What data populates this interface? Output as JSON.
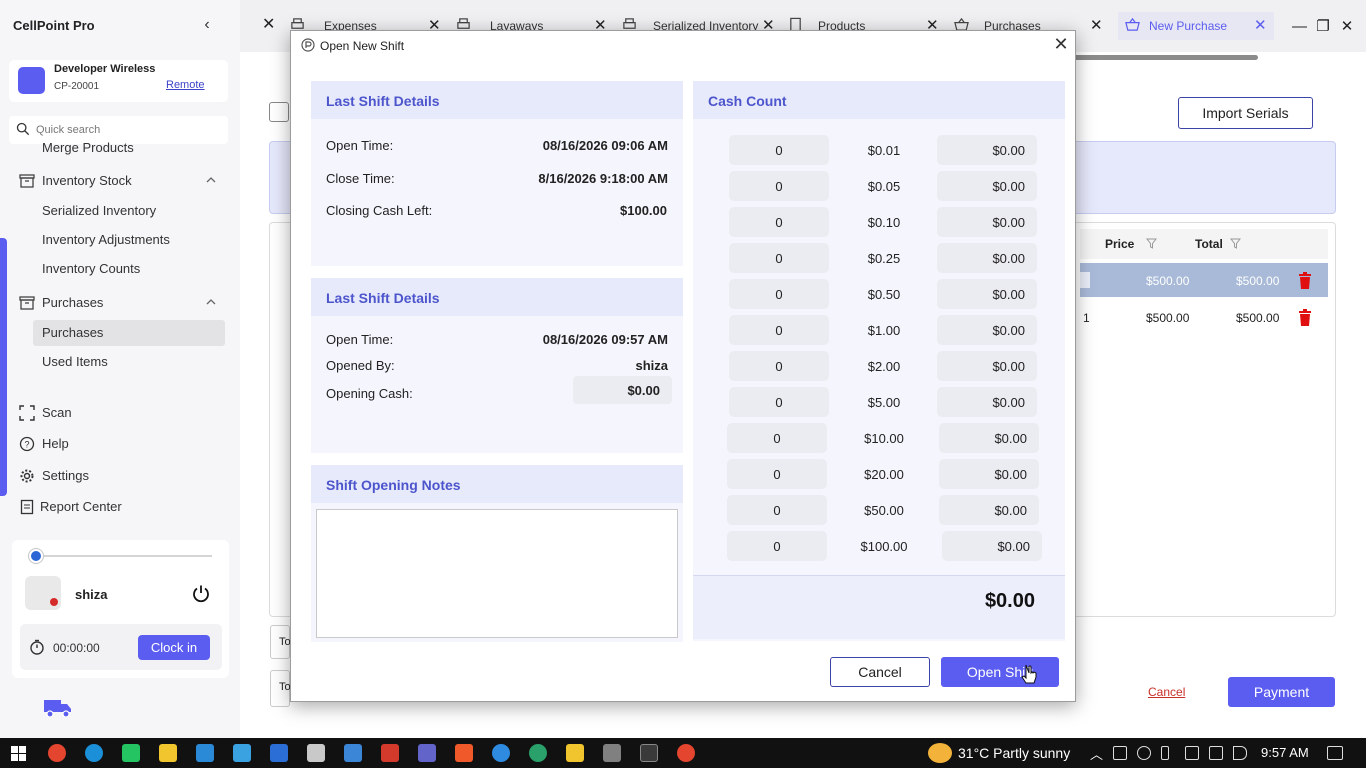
{
  "app": {
    "title": "CellPoint Pro"
  },
  "store": {
    "name": "Developer Wireless",
    "id": "CP-20001",
    "remote_label": "Remote"
  },
  "search": {
    "placeholder": "Quick search"
  },
  "sidebar": {
    "items": [
      {
        "label": "Merge Products"
      },
      {
        "label": "Inventory Stock"
      },
      {
        "label": "Serialized Inventory"
      },
      {
        "label": "Inventory Adjustments"
      },
      {
        "label": "Inventory Counts"
      },
      {
        "label": "Purchases"
      },
      {
        "label": "Purchases"
      },
      {
        "label": "Used Items"
      },
      {
        "label": "Scan"
      },
      {
        "label": "Help"
      },
      {
        "label": "Settings"
      },
      {
        "label": "Report Center"
      }
    ]
  },
  "user": {
    "name": "shiza",
    "timer": "00:00:00",
    "clock_in_label": "Clock in"
  },
  "tabs": [
    {
      "label": "Expenses"
    },
    {
      "label": "Layaways"
    },
    {
      "label": "Serialized Inventory"
    },
    {
      "label": "Products"
    },
    {
      "label": "Purchases"
    },
    {
      "label": "New Purchase"
    }
  ],
  "page": {
    "import_label": "Import Serials",
    "table_headers": {
      "price": "Price",
      "total": "Total"
    },
    "rows": [
      {
        "qty": "",
        "price": "$500.00",
        "total": "$500.00"
      },
      {
        "qty": "1",
        "price": "$500.00",
        "total": "$500.00"
      }
    ],
    "bottom_labels": [
      "To",
      "To"
    ],
    "cancel_label": "Cancel",
    "payment_label": "Payment"
  },
  "modal": {
    "title": "Open New Shift",
    "last_shift": {
      "heading": "Last Shift Details",
      "open_time_label": "Open Time:",
      "open_time": "08/16/2026 09:06 AM",
      "close_time_label": "Close Time:",
      "close_time": "8/16/2026 9:18:00 AM",
      "closing_cash_label": "Closing Cash Left:",
      "closing_cash": "$100.00"
    },
    "current_shift": {
      "heading": "Last Shift Details",
      "open_time_label": "Open Time:",
      "open_time": "08/16/2026 09:57 AM",
      "opened_by_label": "Opened By:",
      "opened_by": "shiza",
      "opening_cash_label": "Opening Cash:",
      "opening_cash": "$0.00"
    },
    "notes": {
      "heading": "Shift Opening Notes",
      "value": ""
    },
    "cash_count": {
      "heading": "Cash Count",
      "rows": [
        {
          "qty": "0",
          "denom": "$0.01",
          "amount": "$0.00"
        },
        {
          "qty": "0",
          "denom": "$0.05",
          "amount": "$0.00"
        },
        {
          "qty": "0",
          "denom": "$0.10",
          "amount": "$0.00"
        },
        {
          "qty": "0",
          "denom": "$0.25",
          "amount": "$0.00"
        },
        {
          "qty": "0",
          "denom": "$0.50",
          "amount": "$0.00"
        },
        {
          "qty": "0",
          "denom": "$1.00",
          "amount": "$0.00"
        },
        {
          "qty": "0",
          "denom": "$2.00",
          "amount": "$0.00"
        },
        {
          "qty": "0",
          "denom": "$5.00",
          "amount": "$0.00"
        },
        {
          "qty": "0",
          "denom": "$10.00",
          "amount": "$0.00"
        },
        {
          "qty": "0",
          "denom": "$20.00",
          "amount": "$0.00"
        },
        {
          "qty": "0",
          "denom": "$50.00",
          "amount": "$0.00"
        },
        {
          "qty": "0",
          "denom": "$100.00",
          "amount": "$0.00"
        }
      ],
      "total": "$0.00"
    },
    "cancel_label": "Cancel",
    "open_label": "Open Shift"
  },
  "taskbar": {
    "weather": "31°C  Partly sunny",
    "time": "9:57 AM"
  },
  "colors": {
    "accent": "#5b5cf0",
    "panel_heading": "#4d55cc",
    "delete": "#e01010"
  }
}
